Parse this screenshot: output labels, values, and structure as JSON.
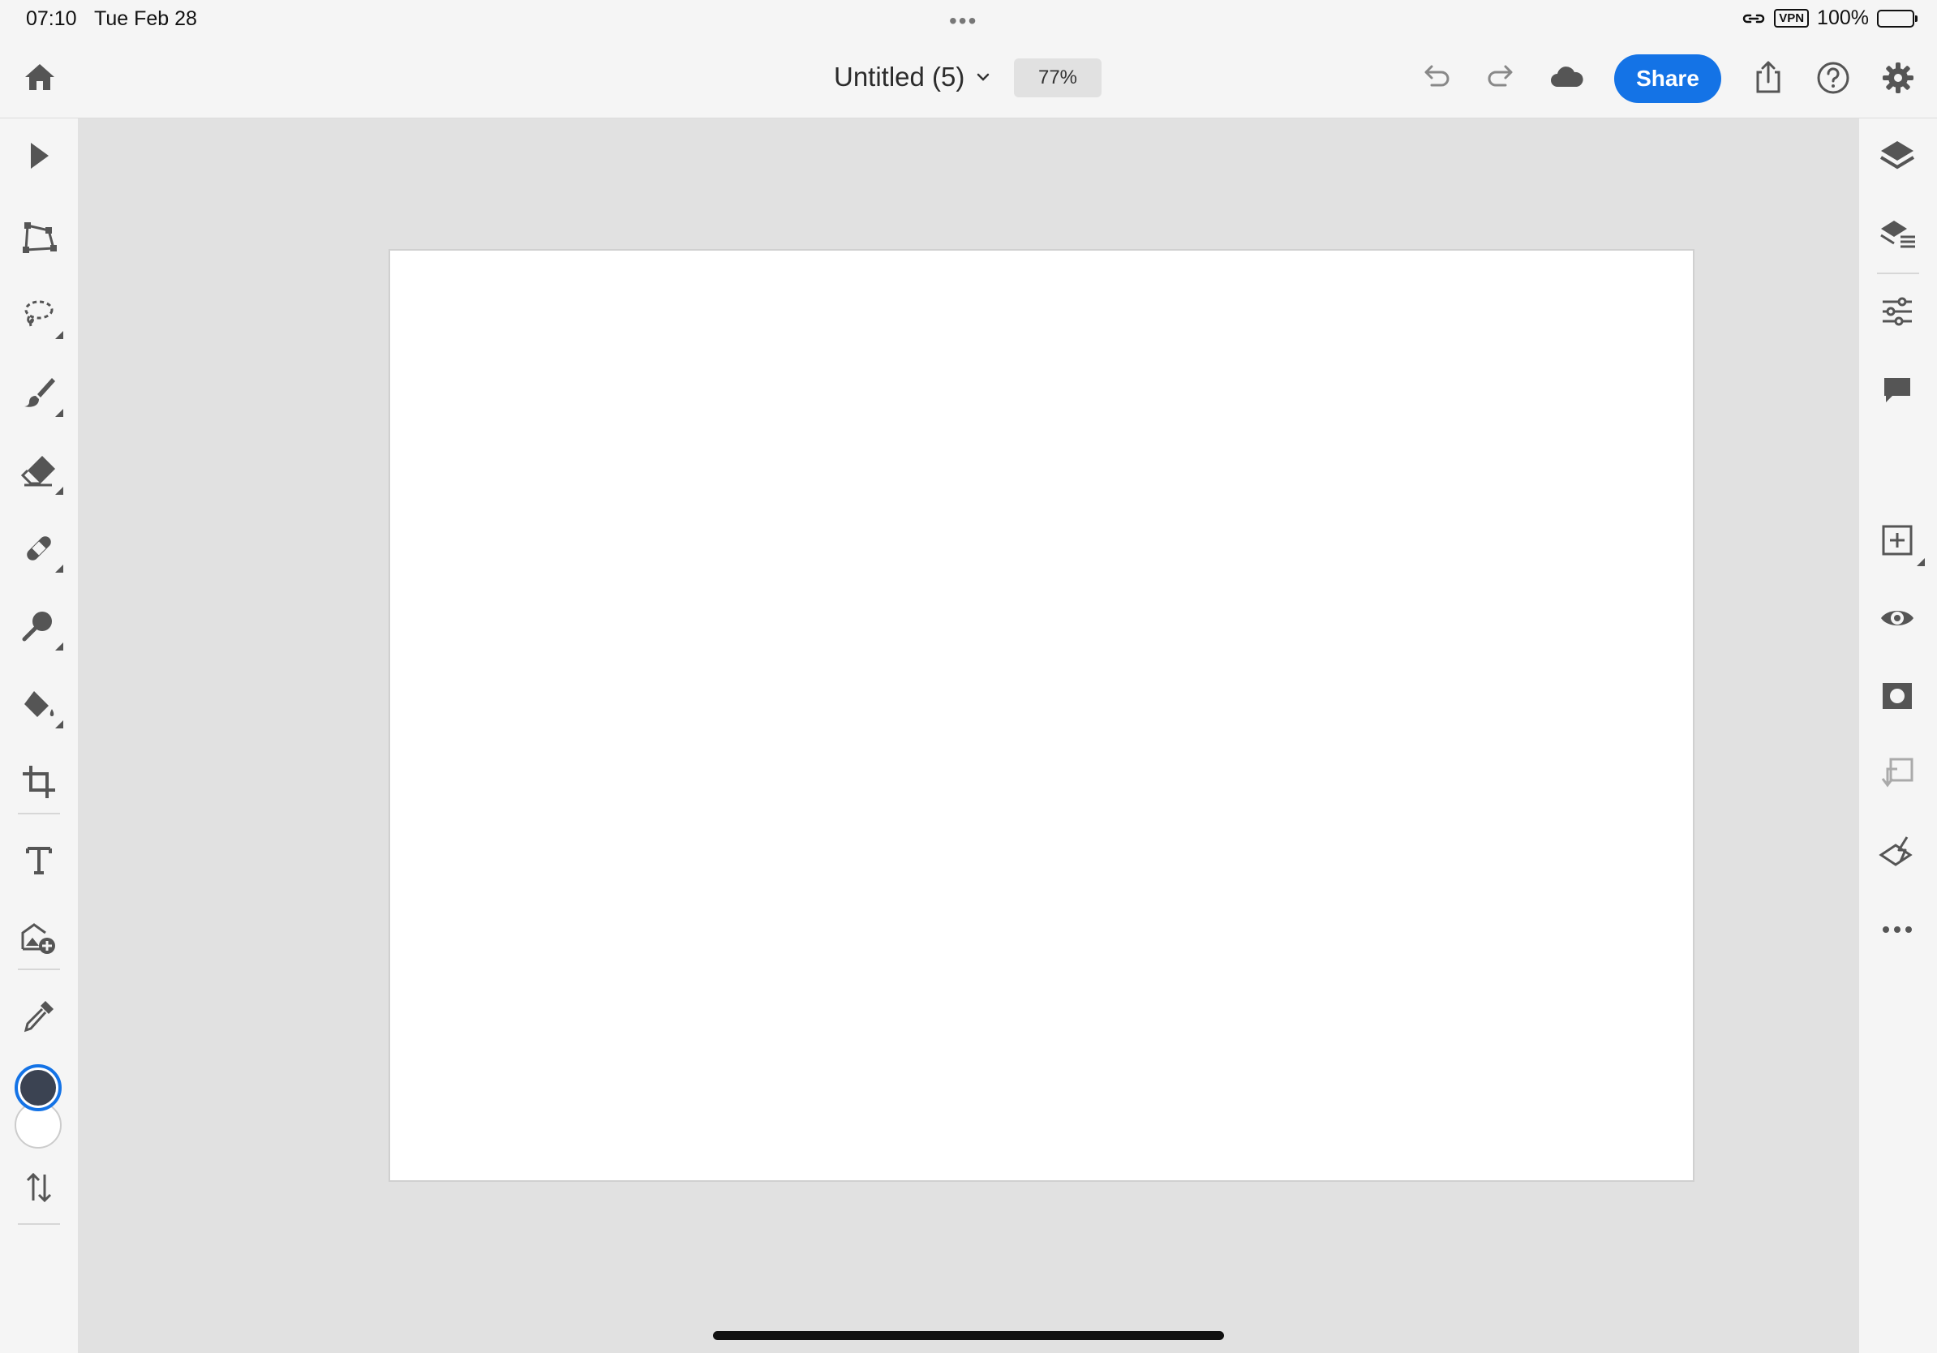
{
  "status_bar": {
    "time": "07:10",
    "date": "Tue Feb 28",
    "vpn_label": "VPN",
    "battery_text": "100%",
    "battery_level": 1.0
  },
  "top_bar": {
    "document_title": "Untitled (5)",
    "zoom_level": "77%",
    "share_label": "Share"
  },
  "left_tools": [
    {
      "name": "select-tool",
      "icon": "arrow-pointer-icon"
    },
    {
      "name": "transform-tool",
      "icon": "transform-icon"
    },
    {
      "name": "lasso-tool",
      "icon": "lasso-icon"
    },
    {
      "name": "brush-tool",
      "icon": "brush-icon"
    },
    {
      "name": "eraser-tool",
      "icon": "eraser-icon"
    },
    {
      "name": "healing-tool",
      "icon": "bandage-icon"
    },
    {
      "name": "dodge-tool",
      "icon": "dodge-icon"
    },
    {
      "name": "fill-tool",
      "icon": "paint-bucket-icon"
    },
    {
      "name": "crop-tool",
      "icon": "crop-icon"
    },
    {
      "name": "type-tool",
      "icon": "text-icon"
    },
    {
      "name": "place-image-tool",
      "icon": "add-image-icon"
    },
    {
      "name": "eyedropper-tool",
      "icon": "eyedropper-icon"
    },
    {
      "name": "swap-colors-tool",
      "icon": "swap-icon"
    }
  ],
  "colors": {
    "foreground": "#3b4352",
    "background": "#ffffff",
    "accent": "#1473e6"
  },
  "right_tools": [
    {
      "name": "layers-panel",
      "icon": "layers-icon"
    },
    {
      "name": "layer-properties",
      "icon": "layer-properties-icon"
    },
    {
      "name": "adjustments",
      "icon": "sliders-icon"
    },
    {
      "name": "comments",
      "icon": "comment-icon"
    },
    {
      "name": "add-layer",
      "icon": "add-square-icon"
    },
    {
      "name": "visibility",
      "icon": "eye-icon"
    },
    {
      "name": "mask",
      "icon": "mask-icon"
    },
    {
      "name": "clipping",
      "icon": "clip-icon"
    },
    {
      "name": "quick-actions",
      "icon": "quick-actions-icon"
    },
    {
      "name": "more",
      "icon": "more-icon"
    }
  ]
}
